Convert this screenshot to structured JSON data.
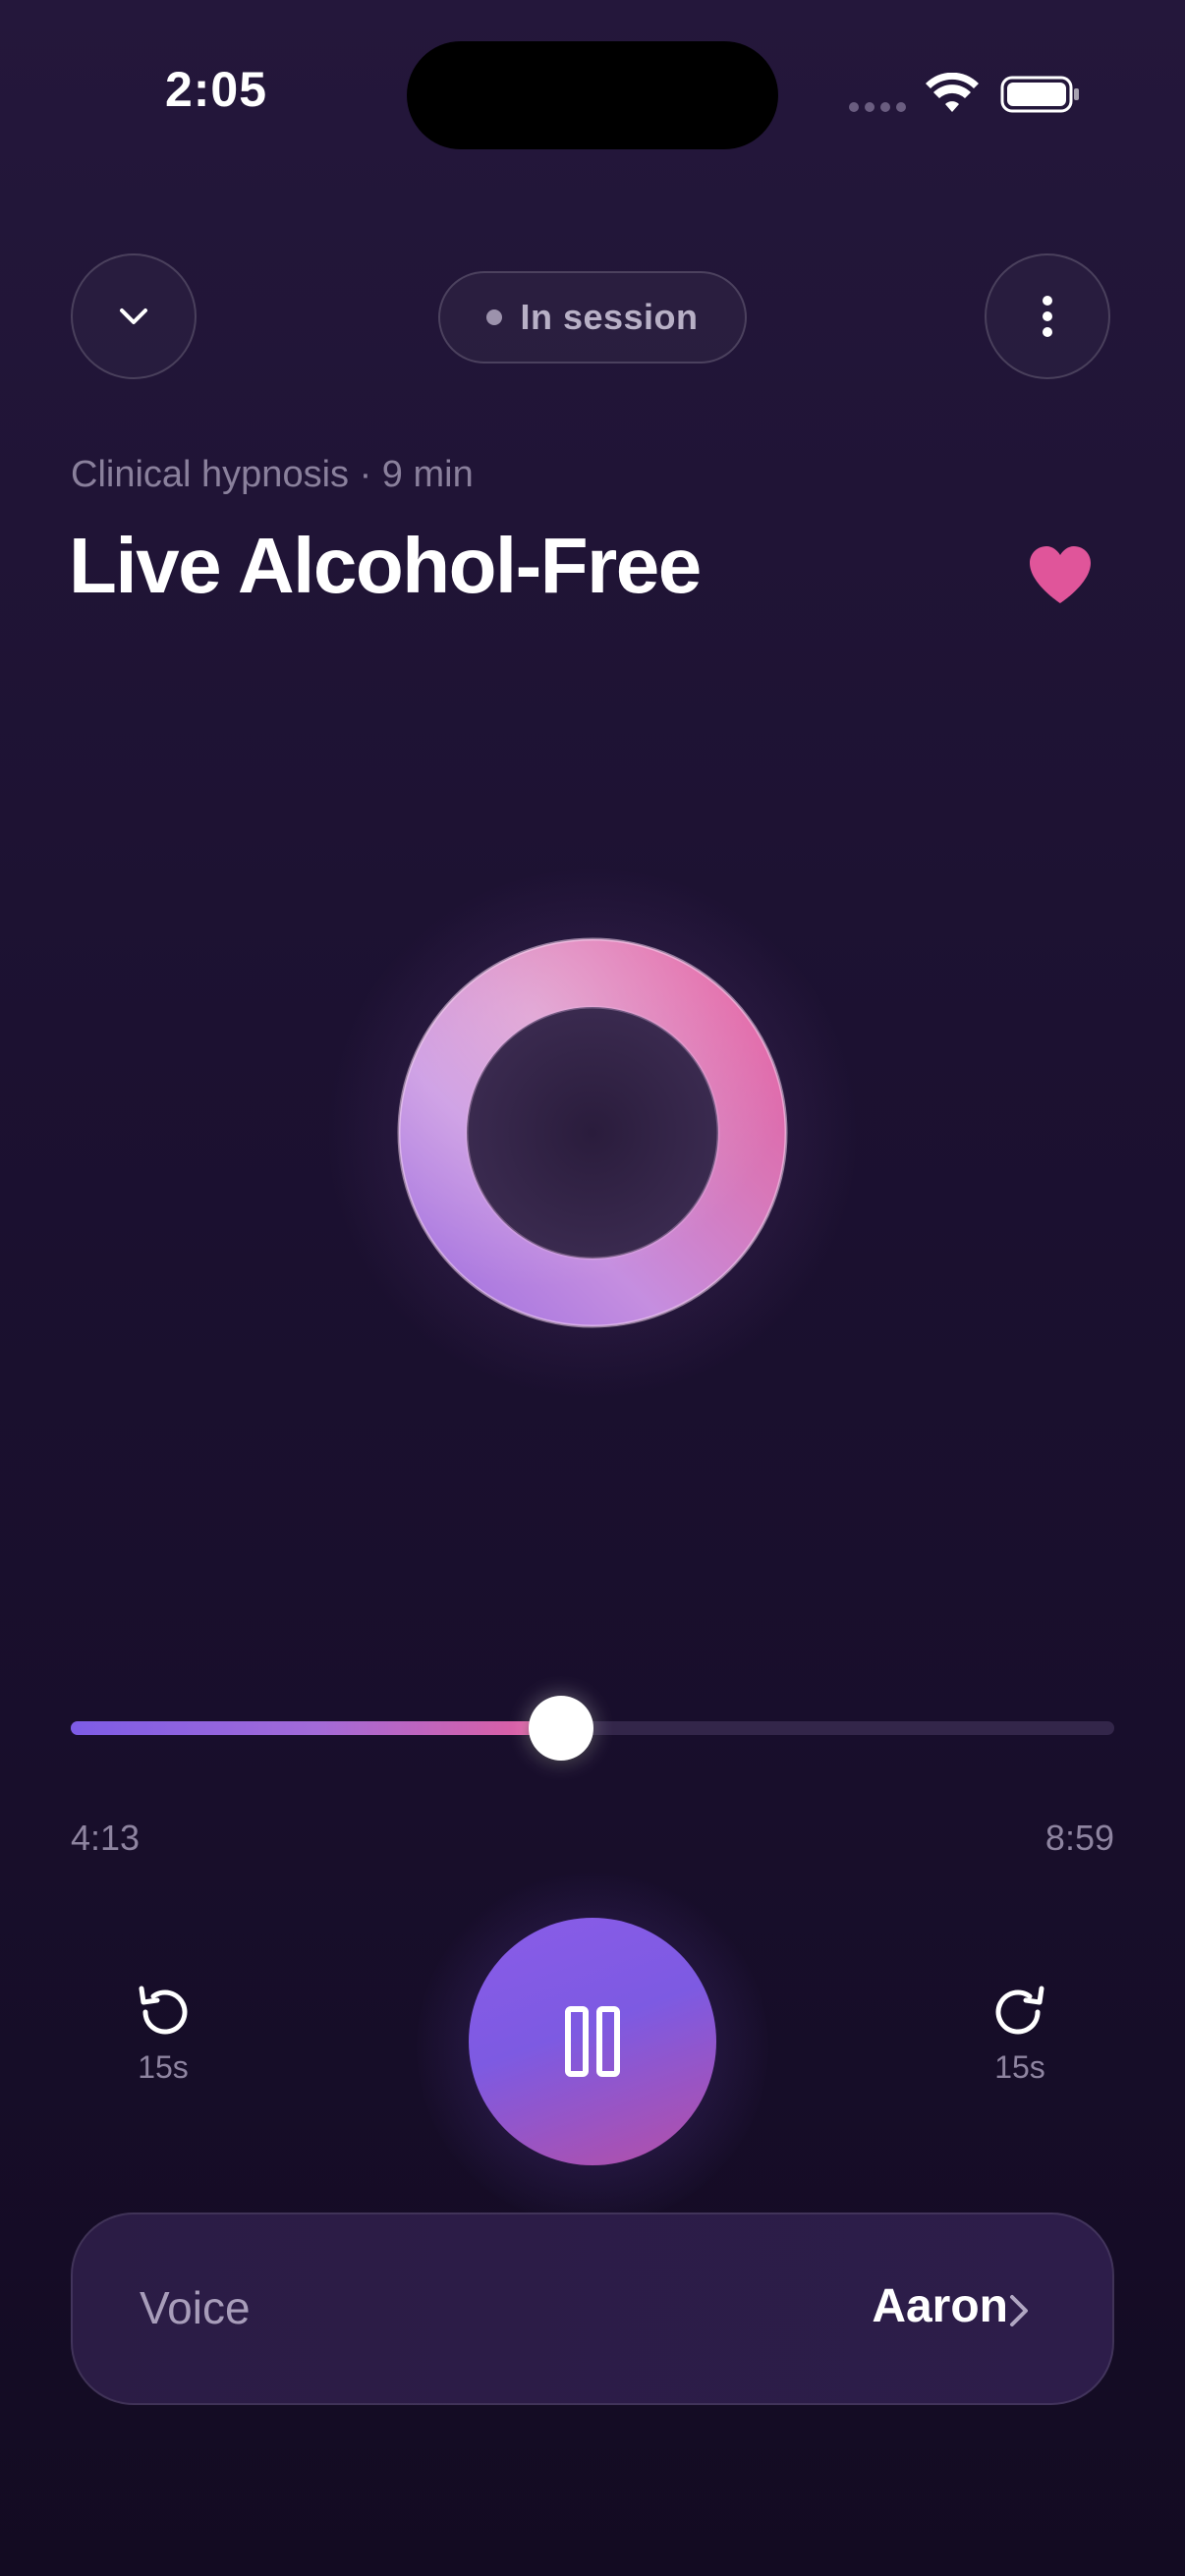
{
  "status_bar": {
    "time": "2:05"
  },
  "header": {
    "collapse_icon": "chevron-down-icon",
    "session_status": "In session",
    "more_icon": "more-vertical-icon"
  },
  "session": {
    "subtitle": "Clinical hypnosis · 9 min",
    "title": "Live Alcohol-Free",
    "favorited": true
  },
  "player": {
    "elapsed": "4:13",
    "duration": "8:59",
    "progress_fraction": 0.47,
    "skip_back_label": "15s",
    "skip_forward_label": "15s",
    "play_state": "playing",
    "pause_icon": "pause-icon"
  },
  "voice": {
    "label": "Voice",
    "value": "Aaron"
  },
  "colors": {
    "background": "#1c1131",
    "accent_purple": "#7d5ce6",
    "accent_pink": "#e45d9c",
    "heart": "#e0559a"
  }
}
